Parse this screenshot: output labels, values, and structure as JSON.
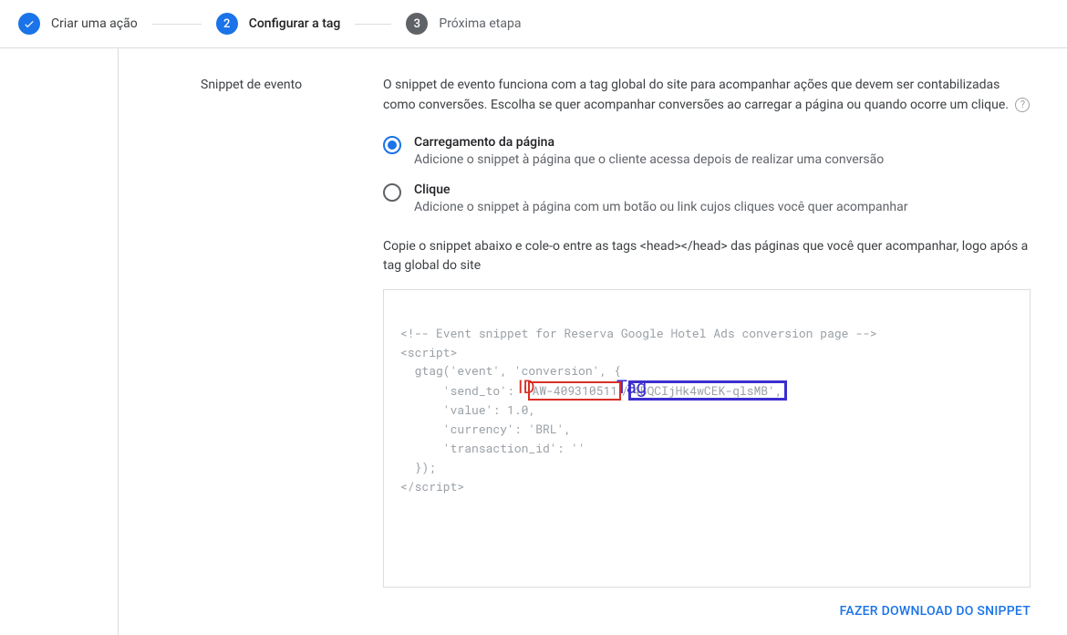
{
  "stepper": {
    "step1": {
      "label": "Criar uma ação"
    },
    "step2": {
      "number": "2",
      "label": "Configurar a tag"
    },
    "step3": {
      "number": "3",
      "label": "Próxima etapa"
    }
  },
  "section": {
    "title": "Snippet de evento",
    "description_part1": "O snippet de evento funciona com a tag global do site para acompanhar ações que devem ser contabilizadas como conversões. Escolha se quer acompanhar conversões ao carregar a página ou quando ocorre um clique.",
    "help_glyph": "?",
    "radio": {
      "pageload": {
        "title": "Carregamento da página",
        "desc": "Adicione o snippet à página que o cliente acessa depois de realizar uma conversão"
      },
      "click": {
        "title": "Clique",
        "desc": "Adicione o snippet à página com um botão ou link cujos cliques você quer acompanhar"
      }
    },
    "copy_instruction": "Copie o snippet abaixo e cole-o entre as tags <head></head> das páginas que você quer acompanhar, logo após a tag global do site",
    "snippet": {
      "l1": "<!-- Event snippet for Reserva Google Hotel Ads conversion page -->",
      "l2": "<script>",
      "l3a": "  gtag('event', 'conversion', {",
      "l4a": "      'send_to': '",
      "l4_id": "AW-409310511",
      "l4b": "/",
      "l4_tag": "4BQCIjHk4wCEK-qlsMB',",
      "l5": "      'value': 1.0,",
      "l6": "      'currency': 'BRL',",
      "l7": "      'transaction_id': ''",
      "l8": "  });",
      "l9": "</script>"
    },
    "annotations": {
      "id_label": "ID",
      "tag_label": "Tag"
    },
    "download_label": "FAZER DOWNLOAD DO SNIPPET"
  }
}
